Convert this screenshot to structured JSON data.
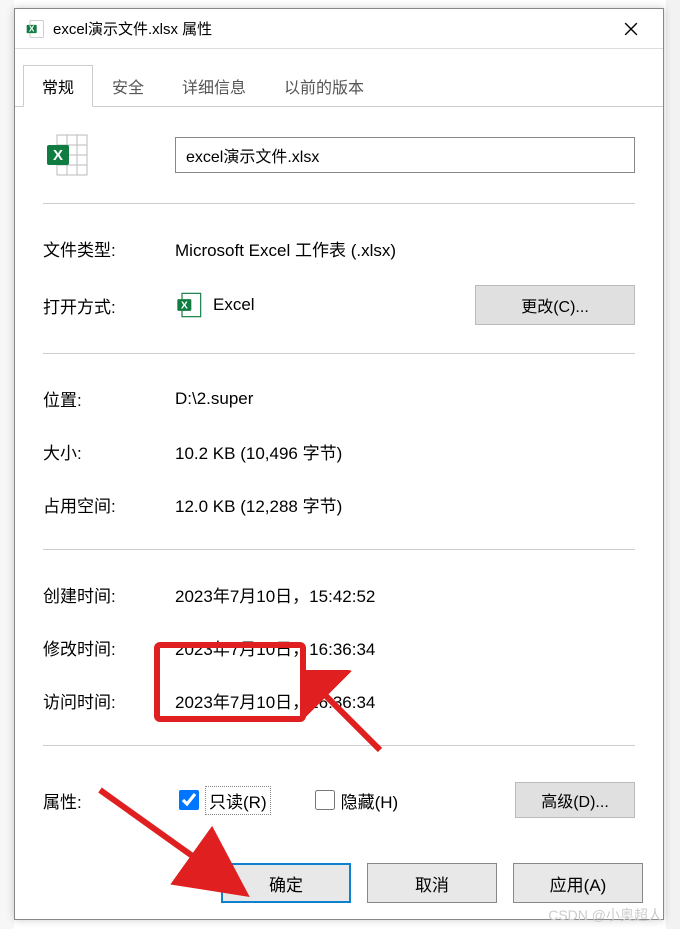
{
  "titlebar": {
    "title": "excel演示文件.xlsx 属性"
  },
  "tabs": {
    "general": "常规",
    "security": "安全",
    "details": "详细信息",
    "previous": "以前的版本"
  },
  "general": {
    "filename": "excel演示文件.xlsx",
    "filetype_label": "文件类型:",
    "filetype_value": "Microsoft Excel 工作表 (.xlsx)",
    "openwith_label": "打开方式:",
    "openwith_app": "Excel",
    "change_label": "更改(C)...",
    "location_label": "位置:",
    "location_value": "D:\\2.super",
    "size_label": "大小:",
    "size_value": "10.2 KB (10,496 字节)",
    "sizeondisk_label": "占用空间:",
    "sizeondisk_value": "12.0 KB (12,288 字节)",
    "created_label": "创建时间:",
    "created_value": "2023年7月10日，15:42:52",
    "modified_label": "修改时间:",
    "modified_value": "2023年7月10日，16:36:34",
    "accessed_label": "访问时间:",
    "accessed_value": "2023年7月10日，16:36:34",
    "attributes_label": "属性:",
    "readonly_label": "只读(R)",
    "hidden_label": "隐藏(H)",
    "advanced_label": "高级(D)..."
  },
  "footer": {
    "ok": "确定",
    "cancel": "取消",
    "apply": "应用(A)"
  },
  "watermark": "CSDN @小奥超人"
}
